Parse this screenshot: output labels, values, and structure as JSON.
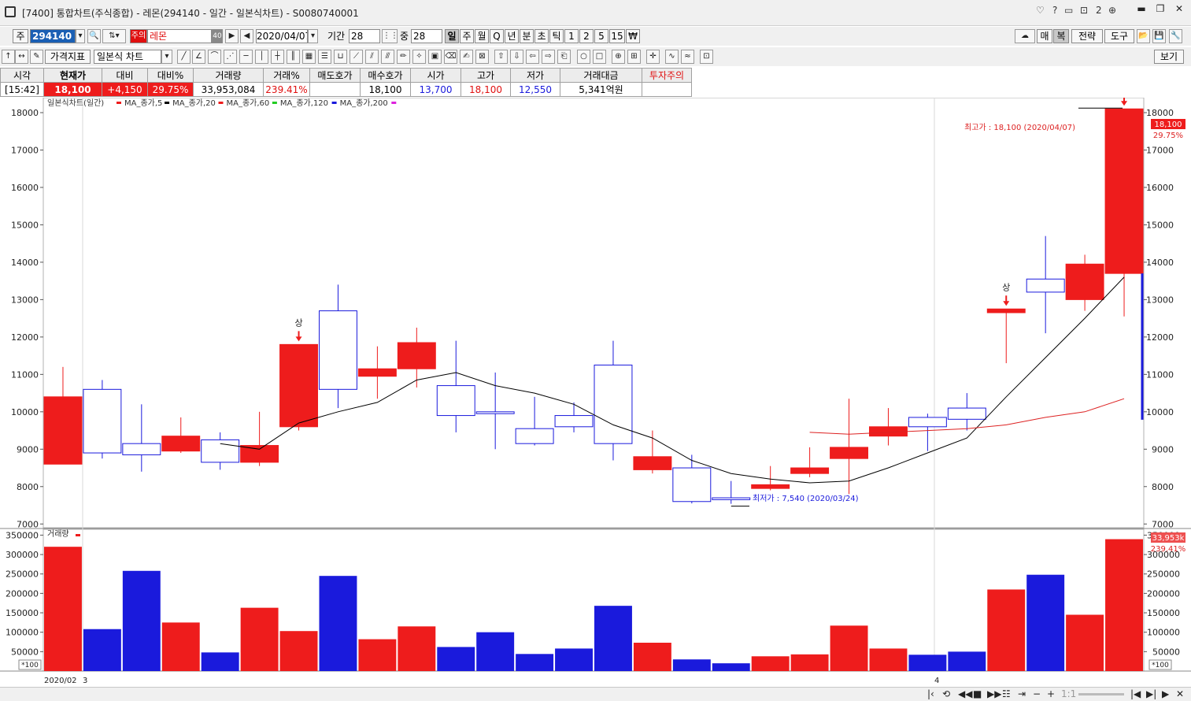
{
  "window": {
    "title": "[7400] 통합차트(주식종합) - 레몬(294140 - 일간 - 일본식차트) - S0080740001",
    "top_icons": [
      "?",
      "2"
    ]
  },
  "toolbar1": {
    "type_label": "주",
    "code": "294140",
    "warn_badge": "주의",
    "stock_name": "레몬",
    "name_badge": "40",
    "date": "2020/04/07",
    "period_label": "기간",
    "period_value": "28",
    "middle_label": "중",
    "middle_value": "28",
    "intervals": [
      "일",
      "주",
      "월",
      "Q",
      "년",
      "분",
      "초",
      "틱",
      "1",
      "2",
      "5",
      "15",
      "₩"
    ],
    "right_buttons": [
      "매",
      "복",
      "전략",
      "도구"
    ]
  },
  "toolbar2": {
    "indicator_label": "가격지표",
    "charttype_label": "일본식 차트",
    "view_label": "보기"
  },
  "quote": {
    "headers": [
      "시각",
      "현재가",
      "대비",
      "대비%",
      "거래량",
      "거래%",
      "매도호가",
      "매수호가",
      "시가",
      "고가",
      "저가",
      "거래대금",
      "투자주의"
    ],
    "values": [
      "[15:42]",
      "18,100",
      "+4,150",
      "29.75%",
      "33,953,084",
      "239.41%",
      "",
      "18,100",
      "13,700",
      "18,100",
      "12,550",
      "5,341억원",
      ""
    ]
  },
  "colors": {
    "up": "#ee1c1c",
    "down": "#1a1adc",
    "ma": "#000000",
    "ma60": "#dd2222"
  },
  "price_panel": {
    "legend": "일본식차트(일간)",
    "ma_labels": [
      "MA_종가,5",
      "MA_종가,20",
      "MA_종가,60",
      "MA_종가,120",
      "MA_종가,200"
    ],
    "ma_colors": [
      "#ee1c1c",
      "#000000",
      "#ee1c1c",
      "#22cc22",
      "#1a1adc",
      "#dd22dd"
    ],
    "high_note": "최고가 : 18,100 (2020/04/07)",
    "low_note": "최저가 : 7,540 (2020/03/24)",
    "limit_mark": "상",
    "current_price_tag": "18,100",
    "current_pct_tag": "29.75%"
  },
  "volume_panel": {
    "legend": "거래량",
    "unit": "*100",
    "volume_tag": "33,953k",
    "volume_pct_tag": "239.41%"
  },
  "xaxis": {
    "start_label": "2020/02",
    "day_label": "3",
    "month_label": "4"
  },
  "chart_data": {
    "type": "candlestick",
    "ylim": [
      6900,
      18400
    ],
    "yticks": [
      7000,
      8000,
      9000,
      10000,
      11000,
      12000,
      13000,
      14000,
      15000,
      16000,
      17000,
      18000
    ],
    "volume_ylim": [
      0,
      365000
    ],
    "volume_yticks": [
      50000,
      100000,
      150000,
      200000,
      250000,
      300000,
      350000
    ],
    "candles": [
      {
        "o": 8600,
        "h": 11200,
        "l": 8600,
        "c": 10400,
        "v": 320000
      },
      {
        "o": 10600,
        "h": 10850,
        "l": 8750,
        "c": 8900,
        "v": 108000
      },
      {
        "o": 9150,
        "h": 10200,
        "l": 8400,
        "c": 8850,
        "v": 258000
      },
      {
        "o": 8950,
        "h": 9850,
        "l": 8900,
        "c": 9350,
        "v": 125000
      },
      {
        "o": 9250,
        "h": 9450,
        "l": 8450,
        "c": 8650,
        "v": 48000
      },
      {
        "o": 8650,
        "h": 10000,
        "l": 8550,
        "c": 9100,
        "v": 163000
      },
      {
        "o": 9600,
        "h": 11800,
        "l": 9500,
        "c": 11800,
        "v": 103000
      },
      {
        "o": 12700,
        "h": 13400,
        "l": 10100,
        "c": 10600,
        "v": 245000
      },
      {
        "o": 10950,
        "h": 11750,
        "l": 10350,
        "c": 11150,
        "v": 82000
      },
      {
        "o": 11150,
        "h": 12250,
        "l": 10650,
        "c": 11850,
        "v": 115000
      },
      {
        "o": 10700,
        "h": 11900,
        "l": 9450,
        "c": 9900,
        "v": 62000
      },
      {
        "o": 10000,
        "h": 11050,
        "l": 9000,
        "c": 9950,
        "v": 100000
      },
      {
        "o": 9550,
        "h": 10400,
        "l": 9100,
        "c": 9150,
        "v": 44000
      },
      {
        "o": 9900,
        "h": 10250,
        "l": 9450,
        "c": 9600,
        "v": 58000
      },
      {
        "o": 11250,
        "h": 11900,
        "l": 8700,
        "c": 9150,
        "v": 168000
      },
      {
        "o": 8450,
        "h": 9500,
        "l": 8350,
        "c": 8800,
        "v": 73000
      },
      {
        "o": 8500,
        "h": 8850,
        "l": 7550,
        "c": 7600,
        "v": 30000
      },
      {
        "o": 7700,
        "h": 8150,
        "l": 7540,
        "c": 7650,
        "v": 20000
      },
      {
        "o": 7950,
        "h": 8550,
        "l": 7900,
        "c": 8050,
        "v": 38000
      },
      {
        "o": 8350,
        "h": 9050,
        "l": 8250,
        "c": 8500,
        "v": 43000
      },
      {
        "o": 8750,
        "h": 10350,
        "l": 7800,
        "c": 9050,
        "v": 117000
      },
      {
        "o": 9350,
        "h": 10100,
        "l": 9100,
        "c": 9600,
        "v": 58000
      },
      {
        "o": 9850,
        "h": 9950,
        "l": 8950,
        "c": 9600,
        "v": 42000
      },
      {
        "o": 10100,
        "h": 10500,
        "l": 9500,
        "c": 9800,
        "v": 50000
      },
      {
        "o": 12650,
        "h": 12750,
        "l": 11300,
        "c": 12750,
        "v": 210000
      },
      {
        "o": 13550,
        "h": 14700,
        "l": 12100,
        "c": 13200,
        "v": 248000
      },
      {
        "o": 13000,
        "h": 14200,
        "l": 12700,
        "c": 13950,
        "v": 145000
      },
      {
        "o": 13700,
        "h": 18100,
        "l": 12550,
        "c": 18100,
        "v": 339531
      }
    ],
    "ma20": [
      null,
      null,
      null,
      null,
      9150,
      9000,
      9700,
      10000,
      10250,
      10850,
      11050,
      10700,
      10500,
      10200,
      9650,
      9300,
      8700,
      8350,
      8200,
      8100,
      8150,
      8500,
      8900,
      9300,
      10400,
      11450,
      12500,
      13600
    ],
    "ma60_start_index": 19,
    "ma60": [
      9450,
      9400,
      9450,
      9500,
      9550,
      9650,
      9850,
      10000,
      10350
    ],
    "limit_up_indices": [
      6,
      24,
      27
    ]
  }
}
